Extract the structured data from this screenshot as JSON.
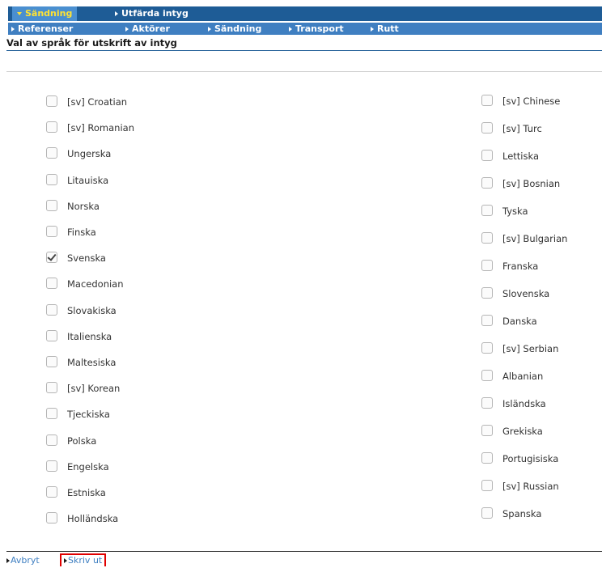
{
  "tabs": {
    "active": "Sändning",
    "other": "Utfärda intyg"
  },
  "subtabs": [
    "Referenser",
    "Aktörer",
    "Sändning",
    "Transport",
    "Rutt"
  ],
  "section_title": "Val av språk för utskrift av intyg",
  "languages_left": [
    {
      "label": "[sv] Croatian",
      "checked": false
    },
    {
      "label": "[sv] Romanian",
      "checked": false
    },
    {
      "label": "Ungerska",
      "checked": false
    },
    {
      "label": "Litauiska",
      "checked": false
    },
    {
      "label": "Norska",
      "checked": false
    },
    {
      "label": "Finska",
      "checked": false
    },
    {
      "label": "Svenska",
      "checked": true
    },
    {
      "label": "Macedonian",
      "checked": false
    },
    {
      "label": "Slovakiska",
      "checked": false
    },
    {
      "label": "Italienska",
      "checked": false
    },
    {
      "label": "Maltesiska",
      "checked": false
    },
    {
      "label": "[sv] Korean",
      "checked": false
    },
    {
      "label": "Tjeckiska",
      "checked": false
    },
    {
      "label": "Polska",
      "checked": false
    },
    {
      "label": "Engelska",
      "checked": false
    },
    {
      "label": "Estniska",
      "checked": false
    },
    {
      "label": "Holländska",
      "checked": false
    }
  ],
  "languages_right": [
    {
      "label": "[sv] Chinese",
      "checked": false
    },
    {
      "label": "[sv] Turc",
      "checked": false
    },
    {
      "label": "Lettiska",
      "checked": false
    },
    {
      "label": "[sv] Bosnian",
      "checked": false
    },
    {
      "label": "Tyska",
      "checked": false
    },
    {
      "label": "[sv] Bulgarian",
      "checked": false
    },
    {
      "label": "Franska",
      "checked": false
    },
    {
      "label": "Slovenska",
      "checked": false
    },
    {
      "label": "Danska",
      "checked": false
    },
    {
      "label": "[sv] Serbian",
      "checked": false
    },
    {
      "label": "Albanian",
      "checked": false
    },
    {
      "label": "Isländska",
      "checked": false
    },
    {
      "label": "Grekiska",
      "checked": false
    },
    {
      "label": "Portugisiska",
      "checked": false
    },
    {
      "label": "[sv] Russian",
      "checked": false
    },
    {
      "label": "Spanska",
      "checked": false
    }
  ],
  "footer": {
    "cancel_label": "Avbryt",
    "print_label": "Skriv ut"
  }
}
